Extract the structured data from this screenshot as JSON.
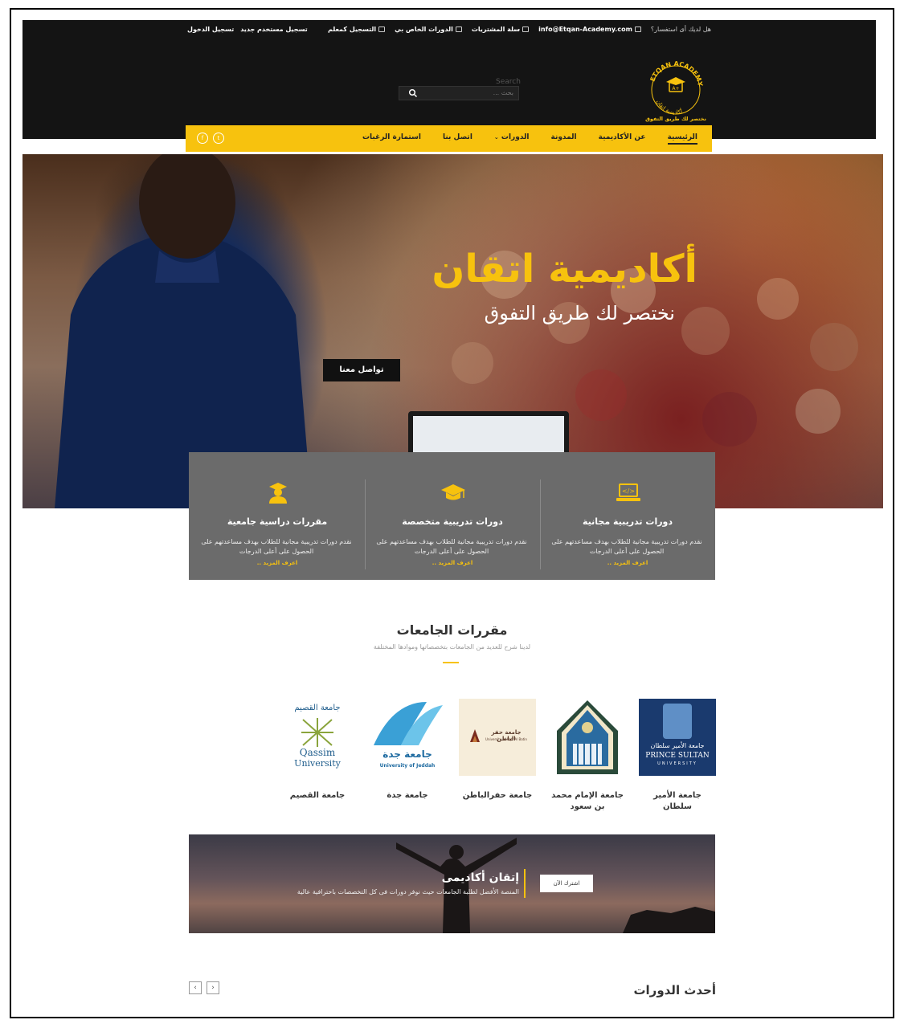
{
  "topbar": {
    "question": "هل لديك أى استفسار؟",
    "email": "info@Etqan-Academy.com",
    "cart": "سلة المشتريات",
    "my_courses": "الدورات الخاص بي",
    "teacher_signup": "التسجيل كمعلم",
    "new_user": "تسجيل مستخدم جديد",
    "login": "تسجيل الدخول"
  },
  "logo": {
    "text_top": "ETQAN ACADEMY",
    "text_ar": "أكاديمية اتقان",
    "tagline": "نختصر لك طريق التفوق"
  },
  "search": {
    "label": "Search",
    "placeholder": "بحث ..."
  },
  "nav": {
    "items": [
      "الرئيسية",
      "عن الأكاديمية",
      "المدونة",
      "الدورات",
      "اتصل بنا",
      "استمارة الرغبات"
    ]
  },
  "hero": {
    "title": "أكاديمية اتقان",
    "subtitle": "نختصر لك طريق التفوق",
    "button": "تواصل معنا"
  },
  "features": [
    {
      "icon": "laptop-code-icon",
      "title": "دورات تدريبية مجانية",
      "desc": "نقدم دورات تدريبية مجانية للطلاب بهدف مساعدتهم على الحصول على أعلى الدرجات",
      "more": "اعرف المزيد .."
    },
    {
      "icon": "graduation-cap-icon",
      "title": "دورات تدريبية متخصصة",
      "desc": "نقدم دورات تدريبية مجانية للطلاب بهدف مساعدتهم على الحصول على أعلى الدرجات",
      "more": "اعرف المزيد .."
    },
    {
      "icon": "graduate-student-icon",
      "title": "مقررات دراسية جامعية",
      "desc": "نقدم دورات تدريبية مجانية للطلاب بهدف مساعدتهم على الحصول على أعلى الدرجات",
      "more": "اعرف المزيد .."
    }
  ],
  "universities": {
    "title": "مقررات الجامعات",
    "subtitle": "لدينا شرح للعديد من الجامعات بتخصصاتها وموادها المختلفة",
    "items": [
      {
        "name": "جامعة الأمير سلطان",
        "logo_text": "جامعة الأمير سلطان",
        "logo_text2": "PRINCE SULTAN",
        "logo_text3": "UNIVERSITY"
      },
      {
        "name": "جامعة الإمام محمد بن سعود",
        "logo_text": "",
        "logo_text2": "",
        "logo_text3": ""
      },
      {
        "name": "جامعة حفرالباطن",
        "logo_text": "جامعة حفر الباطن",
        "logo_text2": "University of Hafr Al Batin",
        "logo_text3": ""
      },
      {
        "name": "جامعة جدة",
        "logo_text": "جامعة جدة",
        "logo_text2": "University of Jeddah",
        "logo_text3": ""
      },
      {
        "name": "جامعة القصيم",
        "logo_text": "جامعة القصيم",
        "logo_text2": "Qassim",
        "logo_text3": "University"
      }
    ]
  },
  "banner": {
    "title": "إتقان أكاديمى",
    "desc": "المنصة الأفضل لطلبة الجامعات حيث نوفر دورات فى كل التخصصات باحترافية عالية",
    "button": "اشترك الآن"
  },
  "latest": {
    "title": "أحدث الدورات",
    "prev": "‹",
    "next": "›"
  },
  "colors": {
    "accent": "#f7c20e",
    "dark": "#141414",
    "feature_bg": "#6b6b6b"
  }
}
